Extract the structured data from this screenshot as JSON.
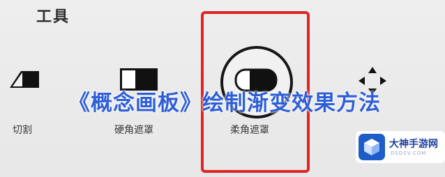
{
  "section": {
    "title": "工具"
  },
  "tools": [
    {
      "label": "切割",
      "icon": "cut-icon"
    },
    {
      "label": "硬角遮罩",
      "icon": "hard-mask-icon"
    },
    {
      "label": "柔角遮罩",
      "icon": "soft-mask-icon",
      "selected": true
    },
    {
      "label": "",
      "icon": "move-icon"
    }
  ],
  "overlay": {
    "title": "《概念画板》绘制渐变效果方法"
  },
  "watermark": {
    "name": "大神手游网",
    "sub": "DSDSV.COM"
  },
  "colors": {
    "selection": "#e02424",
    "title": "#2f5fd6",
    "brand": "#1f3f9e"
  }
}
